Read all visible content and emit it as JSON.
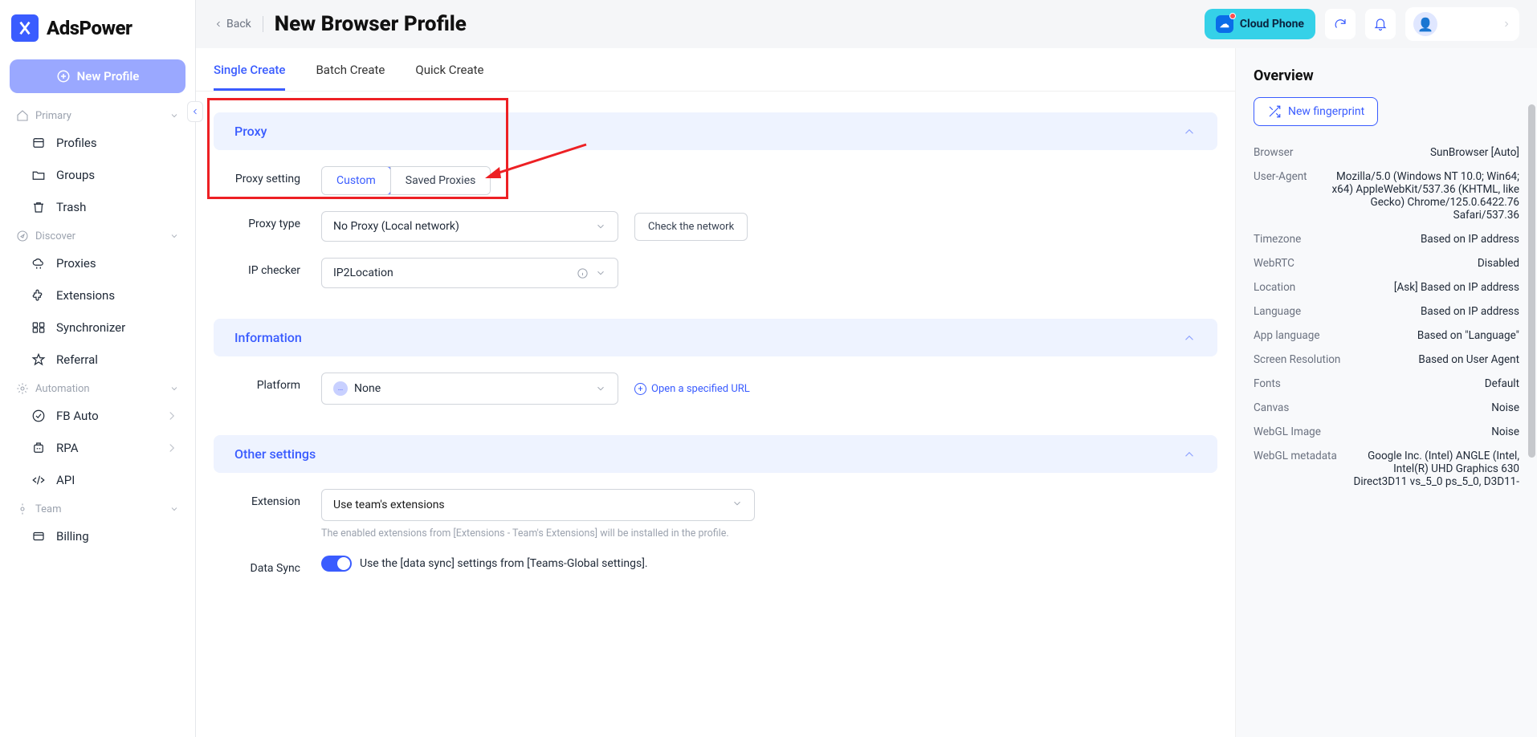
{
  "logo": {
    "text": "AdsPower"
  },
  "new_profile_btn": "New Profile",
  "sidebar": {
    "sections": [
      {
        "label": "Primary",
        "items": [
          {
            "label": "Profiles"
          },
          {
            "label": "Groups"
          },
          {
            "label": "Trash"
          }
        ]
      },
      {
        "label": "Discover",
        "items": [
          {
            "label": "Proxies"
          },
          {
            "label": "Extensions"
          },
          {
            "label": "Synchronizer"
          },
          {
            "label": "Referral"
          }
        ]
      },
      {
        "label": "Automation",
        "items": [
          {
            "label": "FB Auto",
            "has_arrow": true
          },
          {
            "label": "RPA",
            "has_arrow": true
          },
          {
            "label": "API"
          }
        ]
      },
      {
        "label": "Team",
        "items": [
          {
            "label": "Billing"
          }
        ]
      }
    ]
  },
  "topbar": {
    "back": "Back",
    "title": "New Browser Profile",
    "cloud_phone": "Cloud Phone"
  },
  "tabs": [
    {
      "label": "Single Create",
      "active": true
    },
    {
      "label": "Batch Create"
    },
    {
      "label": "Quick Create"
    }
  ],
  "section_proxy": {
    "title": "Proxy",
    "proxy_setting_label": "Proxy setting",
    "seg_custom": "Custom",
    "seg_saved": "Saved Proxies",
    "proxy_type_label": "Proxy type",
    "proxy_type_value": "No Proxy (Local network)",
    "check_network": "Check the network",
    "ip_checker_label": "IP checker",
    "ip_checker_value": "IP2Location"
  },
  "section_info": {
    "title": "Information",
    "platform_label": "Platform",
    "platform_value": "None",
    "url_link": "Open a specified URL"
  },
  "section_other": {
    "title": "Other settings",
    "extension_label": "Extension",
    "extension_value": "Use team's extensions",
    "extension_help": "The enabled extensions from [Extensions - Team's Extensions] will be installed in the profile.",
    "data_sync_label": "Data Sync",
    "data_sync_text": "Use the [data sync] settings from [Teams-Global settings]."
  },
  "overview": {
    "title": "Overview",
    "new_fingerprint": "New fingerprint",
    "rows": [
      {
        "key": "Browser",
        "val": "SunBrowser [Auto]"
      },
      {
        "key": "User-Agent",
        "val": "Mozilla/5.0 (Windows NT 10.0; Win64; x64) AppleWebKit/537.36 (KHTML, like Gecko) Chrome/125.0.6422.76 Safari/537.36"
      },
      {
        "key": "Timezone",
        "val": "Based on IP address"
      },
      {
        "key": "WebRTC",
        "val": "Disabled"
      },
      {
        "key": "Location",
        "val": "[Ask] Based on IP address"
      },
      {
        "key": "Language",
        "val": "Based on IP address"
      },
      {
        "key": "App language",
        "val": "Based on \"Language\""
      },
      {
        "key": "Screen Resolution",
        "val": "Based on User Agent"
      },
      {
        "key": "Fonts",
        "val": "Default"
      },
      {
        "key": "Canvas",
        "val": "Noise"
      },
      {
        "key": "WebGL Image",
        "val": "Noise"
      },
      {
        "key": "WebGL metadata",
        "val": "Google Inc. (Intel) ANGLE (Intel, Intel(R) UHD Graphics 630 Direct3D11 vs_5_0 ps_5_0, D3D11-"
      }
    ]
  }
}
